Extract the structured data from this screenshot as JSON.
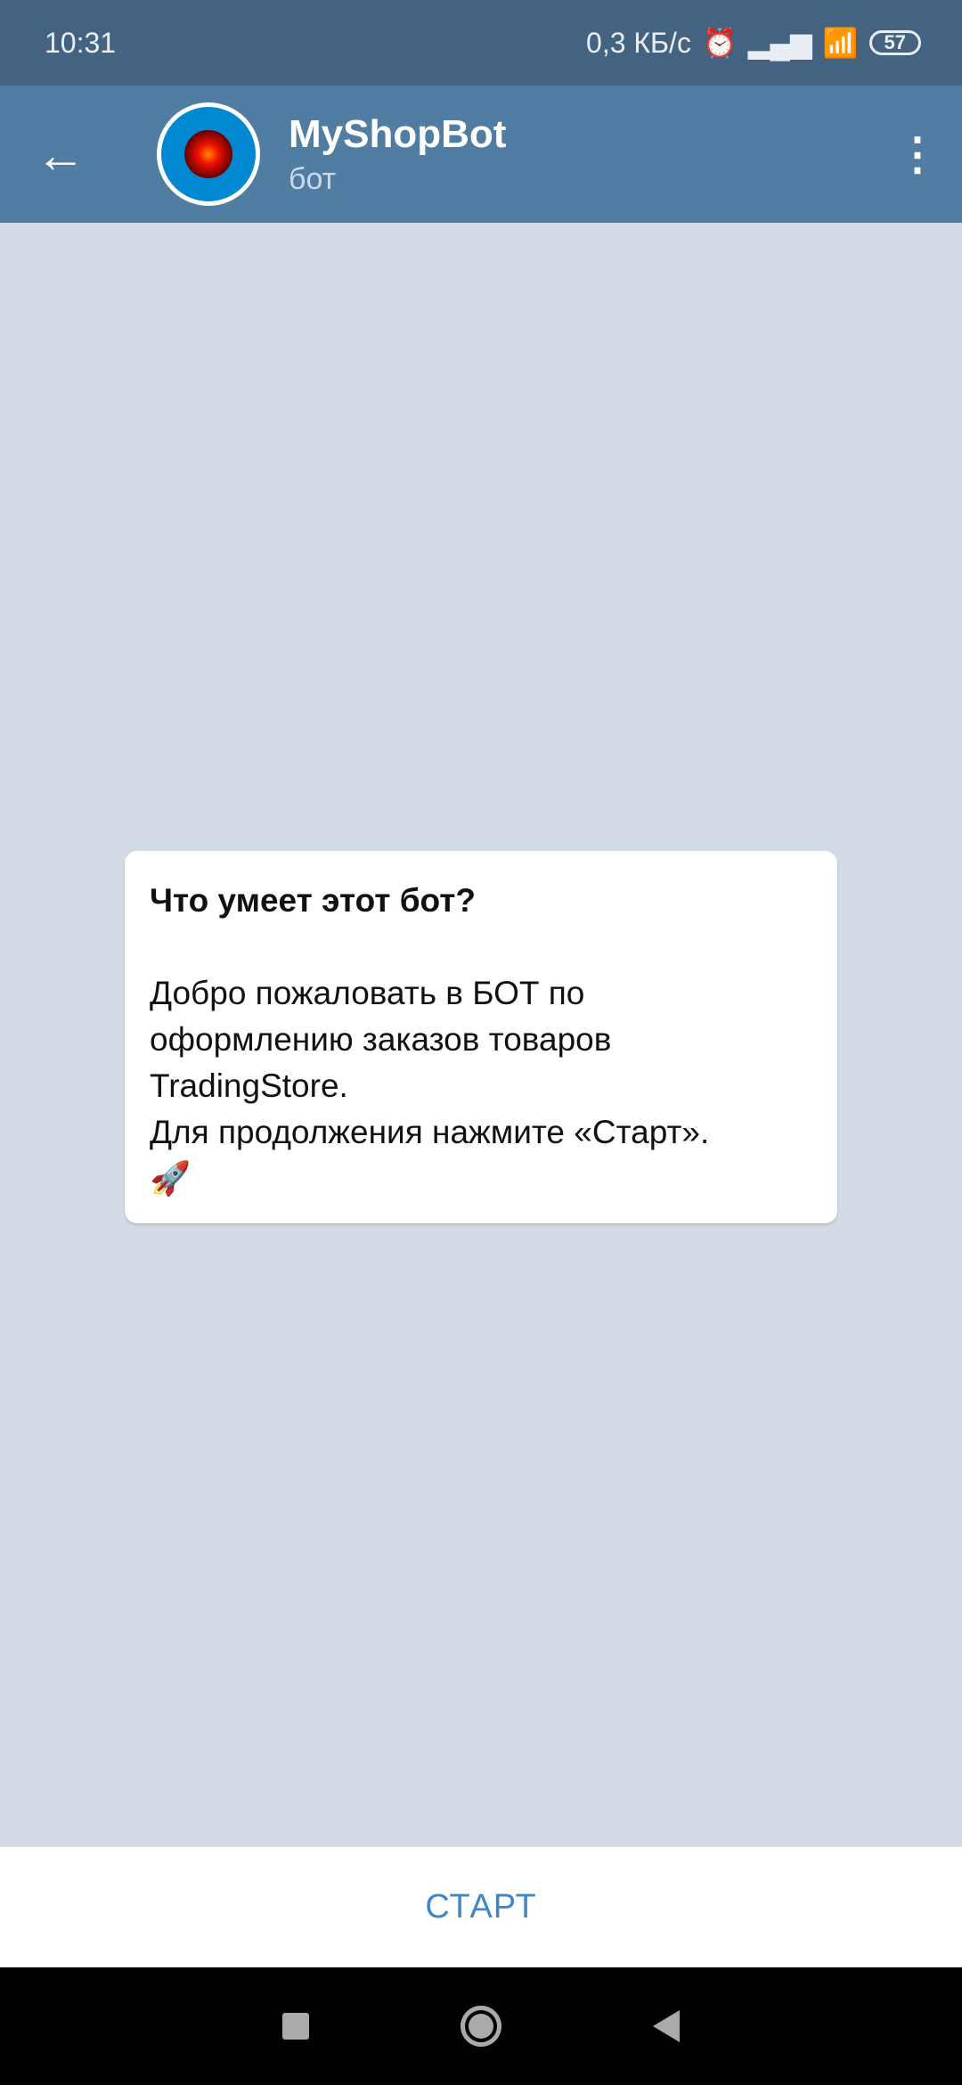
{
  "status_bar": {
    "time": "10:31",
    "net_speed": "0,3 КБ/с",
    "battery": "57"
  },
  "header": {
    "title": "MyShopBot",
    "subtitle": "бот"
  },
  "card": {
    "title": "Что умеет этот бот?",
    "lines": [
      "Добро пожаловать в БОТ по",
      "оформлению заказов товаров",
      "TradingStore.",
      "Для продолжения нажмите «Старт».",
      "🚀"
    ]
  },
  "bottom": {
    "start_label": "СТАРТ"
  }
}
